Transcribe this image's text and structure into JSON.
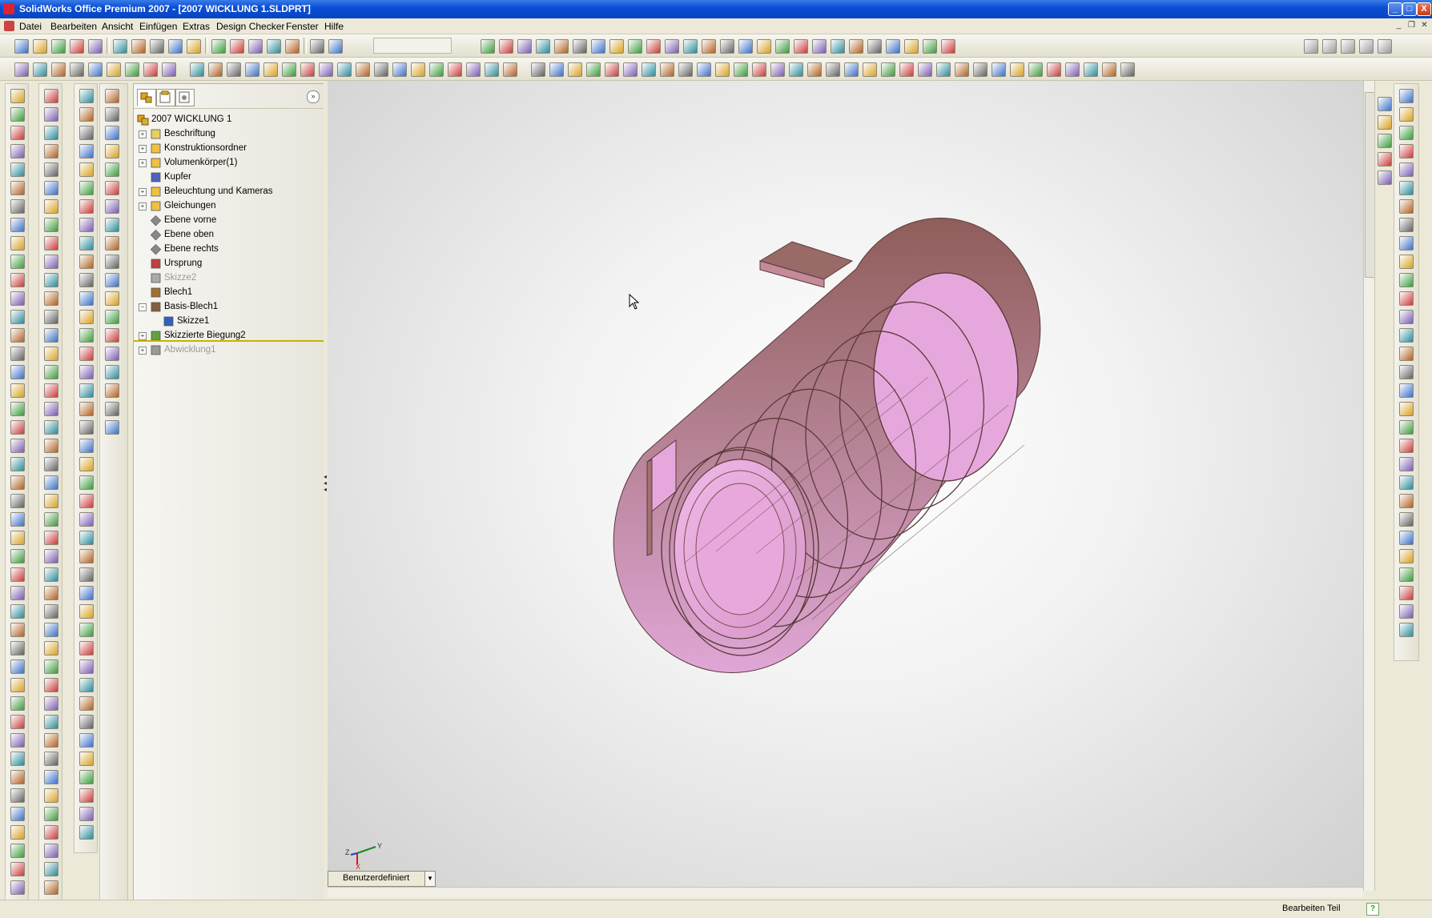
{
  "window": {
    "title": "SolidWorks Office Premium 2007 - [2007 WICKLUNG 1.SLDPRT]",
    "minimize_glyph": "_",
    "maximize_glyph": "□",
    "close_glyph": "X"
  },
  "menu": [
    {
      "label": "Datei"
    },
    {
      "label": "Bearbeiten"
    },
    {
      "label": "Ansicht"
    },
    {
      "label": "Einfügen"
    },
    {
      "label": "Extras"
    },
    {
      "label": "Design Checker"
    },
    {
      "label": "Fenster"
    },
    {
      "label": "Hilfe"
    }
  ],
  "feature_tree": {
    "root": "2007 WICKLUNG 1",
    "items": [
      {
        "label": "Beschriftung",
        "expandable": true,
        "state": "normal"
      },
      {
        "label": "Konstruktionsordner",
        "expandable": true,
        "state": "normal"
      },
      {
        "label": "Volumenkörper(1)",
        "expandable": true,
        "state": "normal"
      },
      {
        "label": "Kupfer",
        "expandable": false,
        "state": "normal"
      },
      {
        "label": "Beleuchtung und Kameras",
        "expandable": true,
        "state": "normal"
      },
      {
        "label": "Gleichungen",
        "expandable": true,
        "state": "normal"
      },
      {
        "label": "Ebene vorne",
        "expandable": false,
        "state": "normal"
      },
      {
        "label": "Ebene oben",
        "expandable": false,
        "state": "normal"
      },
      {
        "label": "Ebene rechts",
        "expandable": false,
        "state": "normal"
      },
      {
        "label": "Ursprung",
        "expandable": false,
        "state": "normal"
      },
      {
        "label": "Skizze2",
        "expandable": false,
        "state": "suppressed"
      },
      {
        "label": "Blech1",
        "expandable": false,
        "state": "normal"
      },
      {
        "label": "Basis-Blech1",
        "expandable": true,
        "state": "expanded"
      },
      {
        "label": "Skizze1",
        "expandable": false,
        "state": "child"
      },
      {
        "label": "Skizzierte Biegung2",
        "expandable": true,
        "state": "normal"
      },
      {
        "label": "Abwicklung1",
        "expandable": true,
        "state": "suppressed"
      }
    ]
  },
  "viewport": {
    "view_orientation": "Benutzerdefiniert",
    "triad_labels": {
      "x": "X",
      "y": "Y",
      "z": "Z"
    },
    "part_color": "#e8a6dc",
    "part_edge_color": "#6a4040"
  },
  "status": {
    "text": "Bearbeiten Teil",
    "help_glyph": "?"
  }
}
